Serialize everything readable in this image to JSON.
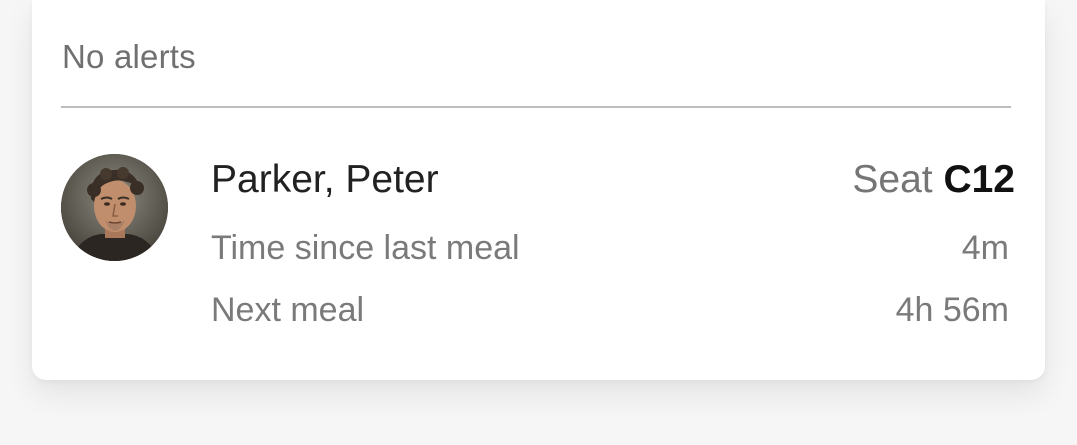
{
  "alerts": {
    "status_text": "No alerts"
  },
  "passenger": {
    "name": "Parker, Peter",
    "seat_label": "Seat",
    "seat_code": "C12",
    "avatar": "portrait-photo"
  },
  "meal_info": [
    {
      "label": "Time since last meal",
      "value": "4m"
    },
    {
      "label": "Next meal",
      "value": "4h 56m"
    }
  ]
}
